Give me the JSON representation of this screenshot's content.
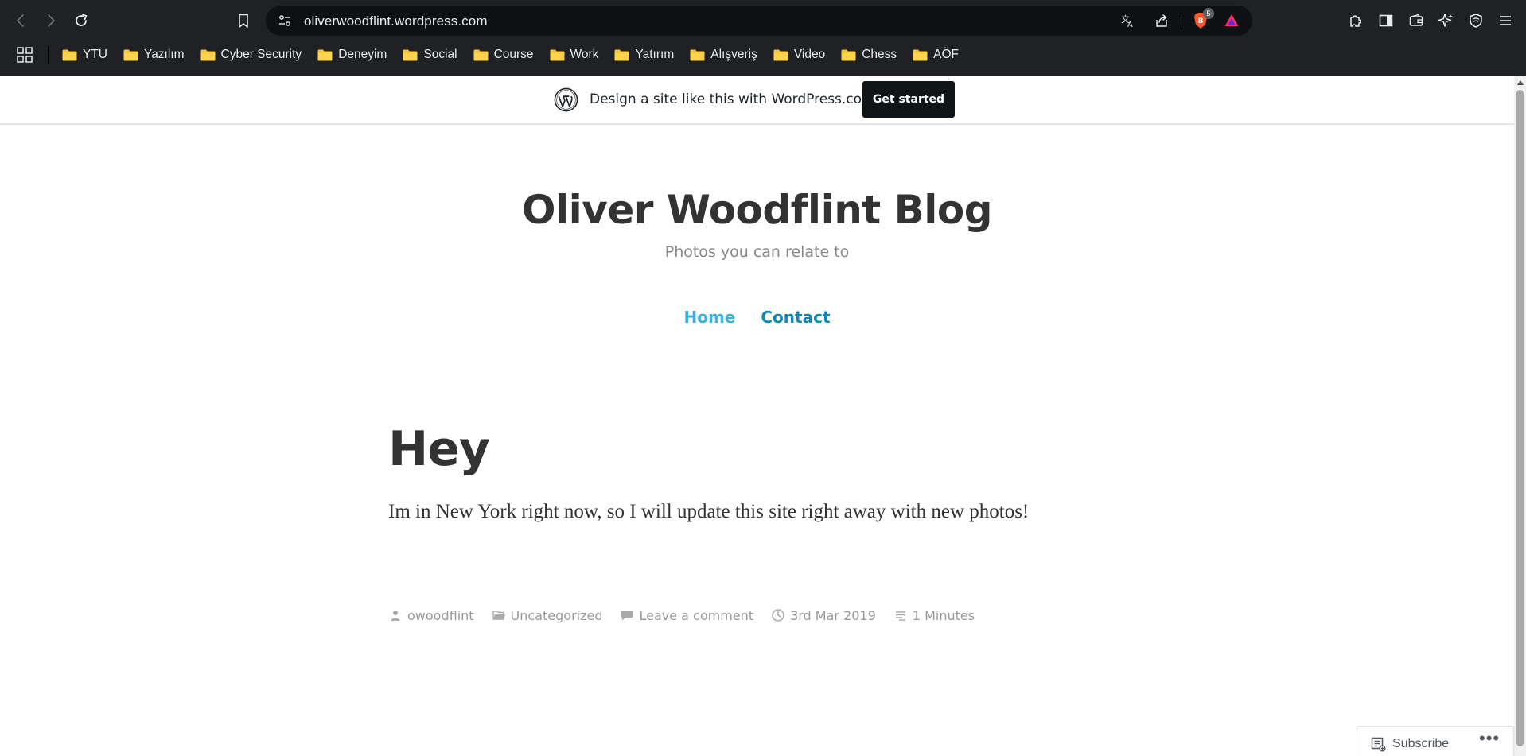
{
  "browser": {
    "url": "oliverwoodflint.wordpress.com",
    "shield_count": "5",
    "bookmarks": [
      "YTU",
      "Yazılım",
      "Cyber Security",
      "Deneyim",
      "Social",
      "Course",
      "Work",
      "Yatırım",
      "Alışveriş",
      "Video",
      "Chess",
      "AÖF"
    ]
  },
  "wp_banner": {
    "text": "Design a site like this with WordPress.com",
    "cta": "Get started"
  },
  "site": {
    "title": "Oliver Woodflint Blog",
    "tagline": "Photos you can relate to",
    "nav": [
      "Home",
      "Contact"
    ]
  },
  "post": {
    "title": "Hey",
    "body": "Im in New York right now, so I will update this site right away with new photos!",
    "meta": {
      "author": "owoodflint",
      "category": "Uncategorized",
      "comments": "Leave a comment",
      "date": "3rd Mar 2019",
      "reading_time": "1 Minutes"
    }
  },
  "subscribe": {
    "label": "Subscribe",
    "more": "•••"
  },
  "colors": {
    "chrome_bg": "#202124",
    "nav_home": "#3fb0d6",
    "nav_contact": "#0f87b8",
    "folder": "#f4c430"
  }
}
